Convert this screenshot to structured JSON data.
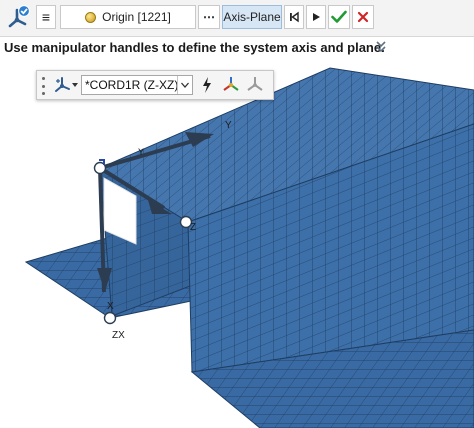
{
  "toolbar": {
    "origin_label": "Origin [1221]",
    "more_label": "⋯",
    "axis_plane_label": "Axis-Plane",
    "icons": [
      "system-tool-icon",
      "menu-icon",
      "origin-icon",
      "more-icon",
      "skip-back-icon",
      "play-icon",
      "check-icon",
      "close-icon"
    ]
  },
  "instruction": {
    "text": "Use manipulator handles to define the system axis and plane.",
    "chevron": "»"
  },
  "microdialog": {
    "system_value": "*CORD1R (Z-XZ)",
    "icons": [
      "grip-icon",
      "axis-type-icon",
      "chevron-down-icon",
      "flip-icon",
      "triad-color-icon",
      "triad-gray-icon"
    ]
  },
  "viewport": {
    "labels": {
      "y_top": "Y",
      "y_small": "Y",
      "z": "Z",
      "x": "X",
      "zx": "ZX"
    }
  },
  "colors": {
    "mesh_fill": "#3d6fa8",
    "mesh_line": "#1e3e63",
    "check_green": "#1f9b32",
    "close_red": "#d32424",
    "axis_arrow": "#2c3d52"
  }
}
